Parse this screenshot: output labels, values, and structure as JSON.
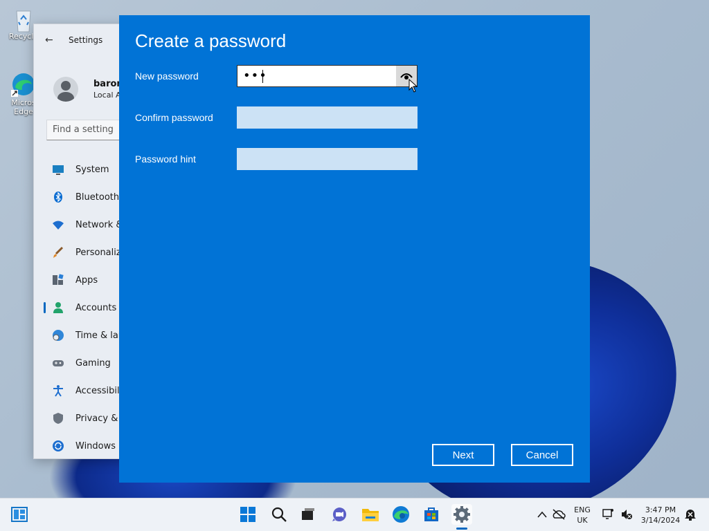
{
  "desktop": {
    "recycle_label": "Recycle",
    "edge_label_1": "Micros",
    "edge_label_2": "Edge"
  },
  "settings": {
    "title": "Settings",
    "user_name": "baron",
    "user_sub": "Local A",
    "search_placeholder": "Find a setting",
    "nav": [
      {
        "label": "System",
        "icon": "monitor-icon"
      },
      {
        "label": "Bluetooth",
        "icon": "bluetooth-icon"
      },
      {
        "label": "Network &",
        "icon": "wifi-icon"
      },
      {
        "label": "Personaliz",
        "icon": "brush-icon"
      },
      {
        "label": "Apps",
        "icon": "apps-icon"
      },
      {
        "label": "Accounts",
        "icon": "person-icon"
      },
      {
        "label": "Time & lar",
        "icon": "clock-globe-icon"
      },
      {
        "label": "Gaming",
        "icon": "gamepad-icon"
      },
      {
        "label": "Accessibili",
        "icon": "accessibility-icon"
      },
      {
        "label": "Privacy & s",
        "icon": "shield-icon"
      },
      {
        "label": "Windows U",
        "icon": "update-icon"
      }
    ]
  },
  "dialog": {
    "title": "Create a password",
    "new_password_label": "New password",
    "new_password_value": "•••",
    "confirm_password_label": "Confirm password",
    "password_hint_label": "Password hint",
    "next_label": "Next",
    "cancel_label": "Cancel",
    "bg_color": "#0173d6"
  },
  "taskbar": {
    "lang_1": "ENG",
    "lang_2": "UK",
    "time": "3:47 PM",
    "date": "3/14/2024"
  }
}
